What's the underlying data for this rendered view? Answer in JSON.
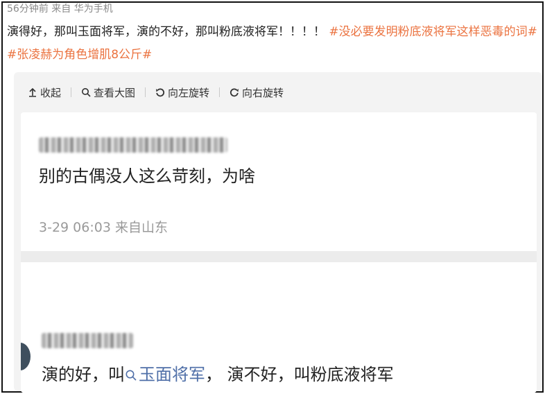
{
  "post": {
    "meta": "56分钟前  来自 华为手机",
    "text": "演得好，那叫玉面将军，演的不好，那叫粉底液将军！！！！",
    "hashtags": [
      "#没必要发明粉底液将军这样恶毒的词#",
      "#张凌赫为角色增肌8公斤#"
    ]
  },
  "toolbar": {
    "collapse": "收起",
    "view_large": "查看大图",
    "rotate_left": "向左旋转",
    "rotate_right": "向右旋转"
  },
  "image": {
    "comment1": {
      "text": "别的古偶没人这么苛刻，为啥",
      "time": "3-29 06:03  来自山东"
    },
    "comment2": {
      "prefix": "演的好，叫",
      "link": "玉面将军",
      "suffix": "，  演不好，叫粉底液将军"
    }
  },
  "colors": {
    "hashtag": "#eb7340",
    "link": "#4f6fa8"
  }
}
